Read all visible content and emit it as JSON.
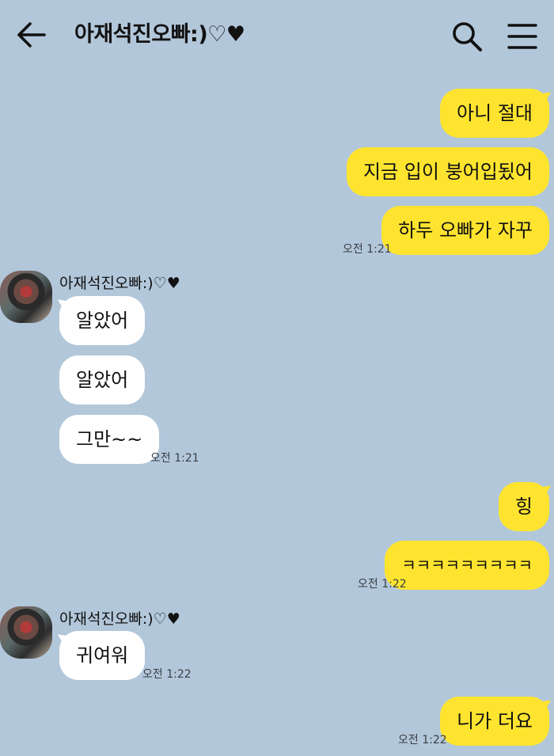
{
  "header": {
    "back_icon": "back-arrow-icon",
    "title": "아재석진오빠:)♡♥",
    "search_icon": "search-icon",
    "menu_icon": "hamburger-menu-icon"
  },
  "messages": [
    {
      "sender": "me",
      "text": "아니 절대"
    },
    {
      "sender": "me",
      "text": "지금 입이 붕어입됬어"
    },
    {
      "sender": "me",
      "text": "하두 오빠가 자꾸",
      "time": "오전 1:21"
    },
    {
      "sender": "them",
      "name": "아재석진오빠:)♡♥",
      "text": "알았어"
    },
    {
      "sender": "them",
      "text": "알았어"
    },
    {
      "sender": "them",
      "text": "그만~~",
      "time": "오전 1:21"
    },
    {
      "sender": "me",
      "text": "힝"
    },
    {
      "sender": "me",
      "text": "ㅋㅋㅋㅋㅋㅋㅋㅋㅋ",
      "time": "오전 1:22"
    },
    {
      "sender": "them",
      "name": "아재석진오빠:)♡♥",
      "text": "귀여워",
      "time": "오전 1:22"
    },
    {
      "sender": "me",
      "text": "니가 더요",
      "time": "오전 1:22"
    }
  ],
  "colors": {
    "background": "#b2c7da",
    "my_bubble": "#fee42f",
    "their_bubble": "#ffffff"
  }
}
